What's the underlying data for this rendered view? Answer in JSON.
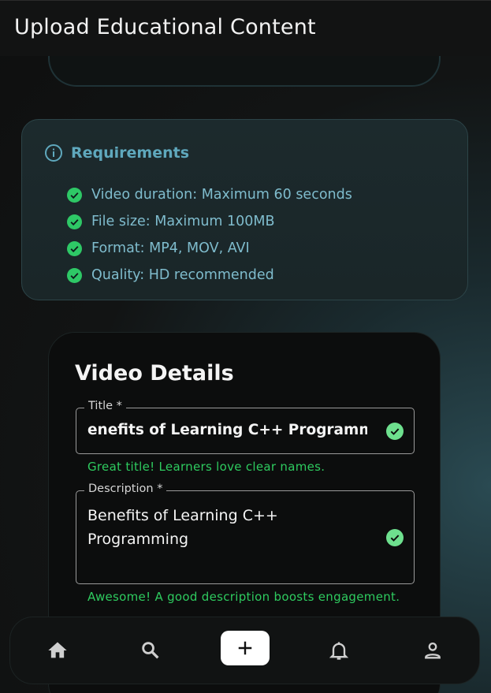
{
  "appbar": {
    "title": "Upload Educational Content"
  },
  "requirements": {
    "title": "Requirements",
    "items": [
      "Video duration: Maximum 60 seconds",
      "File size: Maximum 100MB",
      "Format: MP4, MOV, AVI",
      "Quality: HD recommended"
    ]
  },
  "details": {
    "title": "Video Details",
    "title_field": {
      "label": "Title *",
      "value": "enefits of Learning C++ Programming",
      "helper": "Great title! Learners love clear names."
    },
    "description_field": {
      "label": "Description *",
      "value_line1": "Benefits of Learning C++",
      "value_line2": "Programming",
      "helper": "Awesome! A good description boosts engagement."
    }
  },
  "nav": {
    "items": [
      "home-icon",
      "search-icon",
      "add-icon",
      "bell-icon",
      "person-icon"
    ]
  },
  "colors": {
    "accent": "#5fa8bd",
    "success": "#2ec866",
    "appbar": "#121313"
  }
}
